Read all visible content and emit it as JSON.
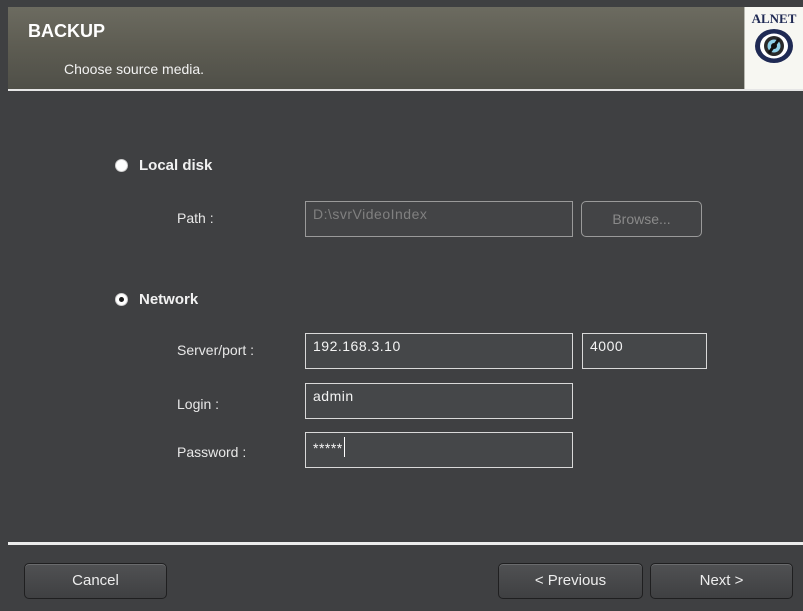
{
  "header": {
    "title": "BACKUP",
    "subtitle": "Choose source media.",
    "logo_text": "ALNET",
    "logo_icon": "eye-lens-icon"
  },
  "local_disk": {
    "label": "Local disk",
    "selected": false,
    "path_label": "Path :",
    "path_value": "D:\\svrVideoIndex",
    "browse_label": "Browse..."
  },
  "network": {
    "label": "Network",
    "selected": true,
    "server_label": "Server/port :",
    "server_value": "192.168.3.10",
    "port_value": "4000",
    "login_label": "Login :",
    "login_value": "admin",
    "password_label": "Password :",
    "password_value": "*****"
  },
  "footer": {
    "cancel_label": "Cancel",
    "previous_label": "< Previous",
    "next_label": "Next >"
  },
  "colors": {
    "background": "#3f4042",
    "header": "#5d5c52",
    "logo_blue": "#1f2a54"
  }
}
